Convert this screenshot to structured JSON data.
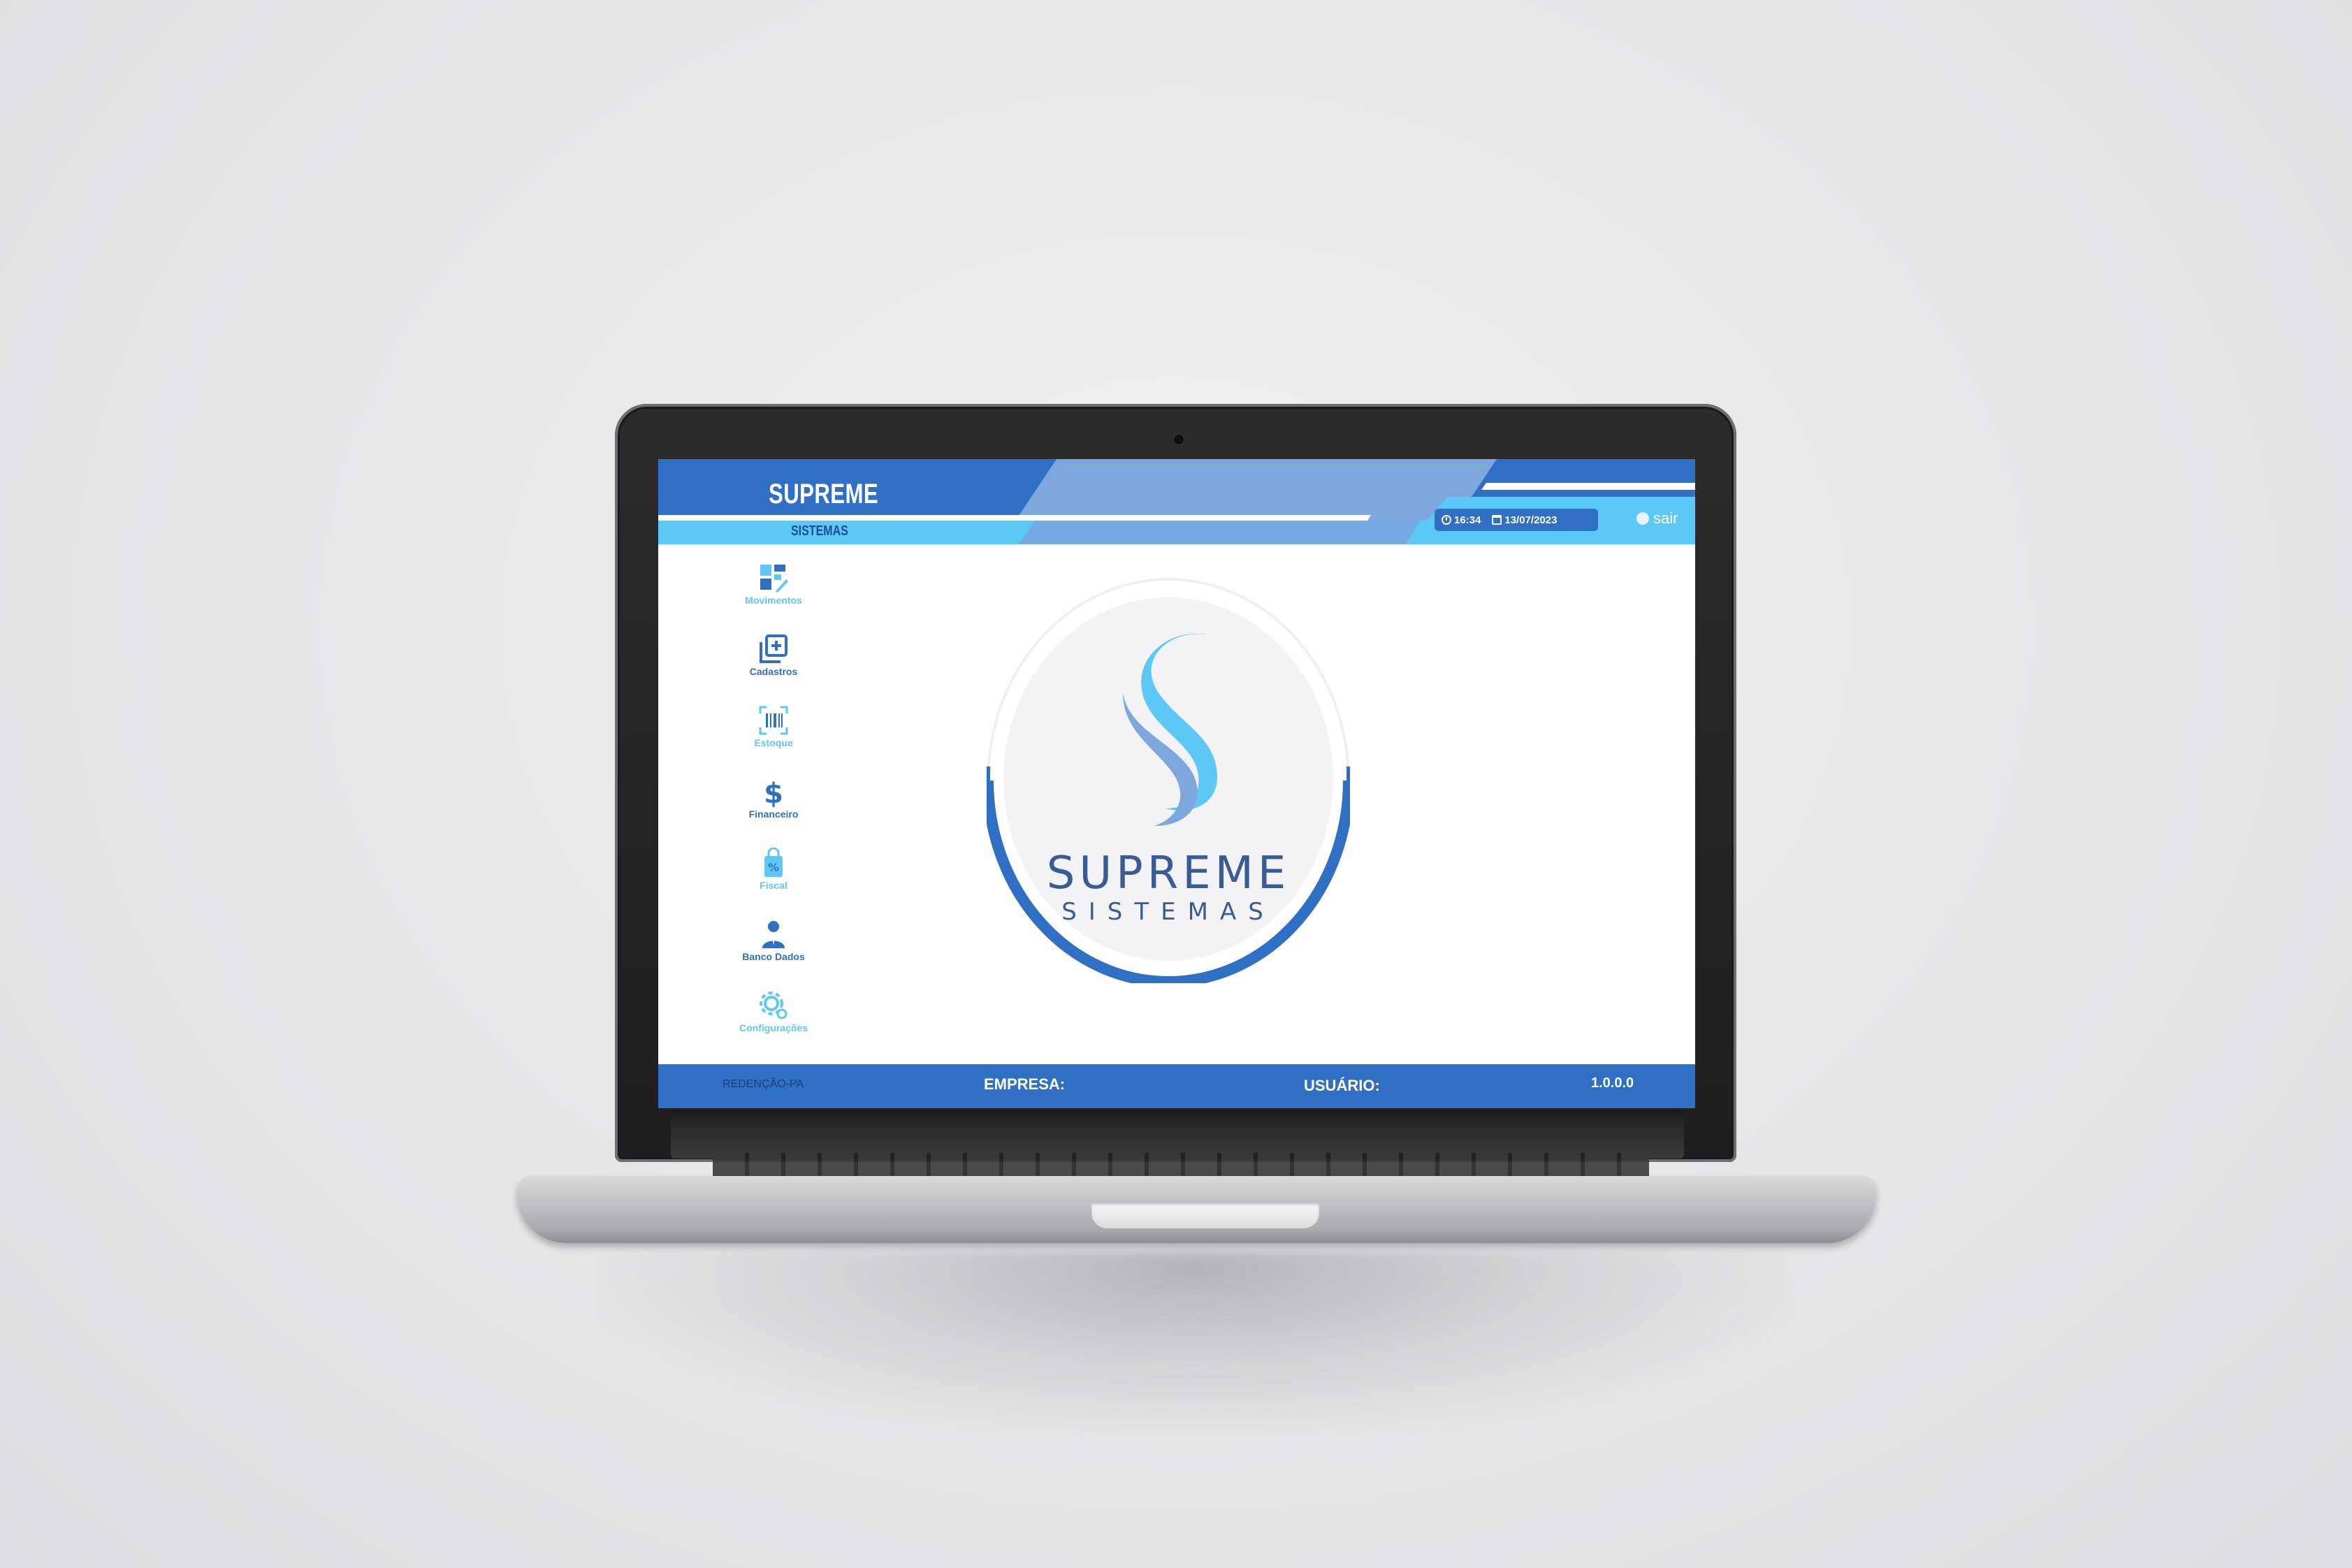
{
  "header": {
    "brand_title": "SUPREME",
    "brand_subtitle": "SISTEMAS",
    "time": "16:34",
    "date": "13/07/2023",
    "logout_label": "sair"
  },
  "sidebar": {
    "items": [
      {
        "label": "Movimentos",
        "icon": "grid-edit-icon",
        "color": "#5cc8f5"
      },
      {
        "label": "Cadastros",
        "icon": "add-stack-icon",
        "color": "#2f6fc4"
      },
      {
        "label": "Estoque",
        "icon": "barcode-icon",
        "color": "#5cc8f5"
      },
      {
        "label": "Financeiro",
        "icon": "dollar-icon",
        "color": "#2f6fc4"
      },
      {
        "label": "Fiscal",
        "icon": "percent-tag-icon",
        "color": "#5cc8f5"
      },
      {
        "label": "Banco Dados",
        "icon": "user-icon",
        "color": "#2f6fc4"
      },
      {
        "label": "Configurações",
        "icon": "gear-icon",
        "color": "#5cc8f5"
      }
    ]
  },
  "logo": {
    "name": "SUPREME",
    "subtitle": "SISTEMAS"
  },
  "footer": {
    "city": "REDENÇÃO-PA",
    "company_label": "EMPRESA:",
    "user_label": "USUÁRIO:",
    "version": "1.0.0.0"
  },
  "colors": {
    "primary": "#2f6fc4",
    "accent": "#5cc8f5",
    "light_blue": "#7ea7dd"
  }
}
